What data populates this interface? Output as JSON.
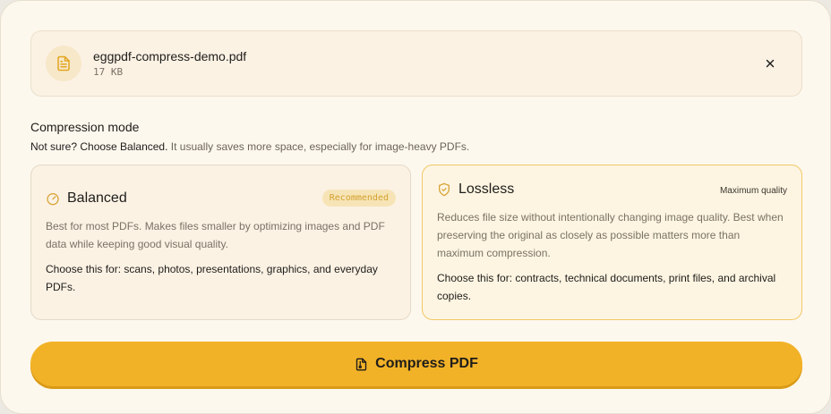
{
  "file": {
    "name": "eggpdf-compress-demo.pdf",
    "size": "17 KB"
  },
  "compression": {
    "title": "Compression mode",
    "hint_strong": "Not sure? Choose Balanced.",
    "hint_rest": " It usually saves more space, especially for image-heavy PDFs."
  },
  "options": {
    "balanced": {
      "title": "Balanced",
      "badge": "Recommended",
      "description": "Best for most PDFs. Makes files smaller by optimizing images and PDF data while keeping good visual quality.",
      "use_for": "Choose this for: scans, photos, presentations, graphics, and everyday PDFs."
    },
    "lossless": {
      "title": "Lossless",
      "badge": "Maximum quality",
      "description": "Reduces file size without intentionally changing image quality. Best when preserving the original as closely as possible matters more than maximum compression.",
      "use_for": "Choose this for: contracts, technical documents, print files, and archival copies."
    }
  },
  "actions": {
    "compress_label": "Compress PDF"
  },
  "colors": {
    "accent": "#f2b227",
    "selected_border": "#f0c866",
    "badge_text": "#d2a12e"
  },
  "icons": {
    "file": "file-text-icon",
    "close": "close-icon",
    "balanced": "gauge-icon",
    "lossless": "shield-check-icon",
    "compress": "file-archive-icon"
  }
}
